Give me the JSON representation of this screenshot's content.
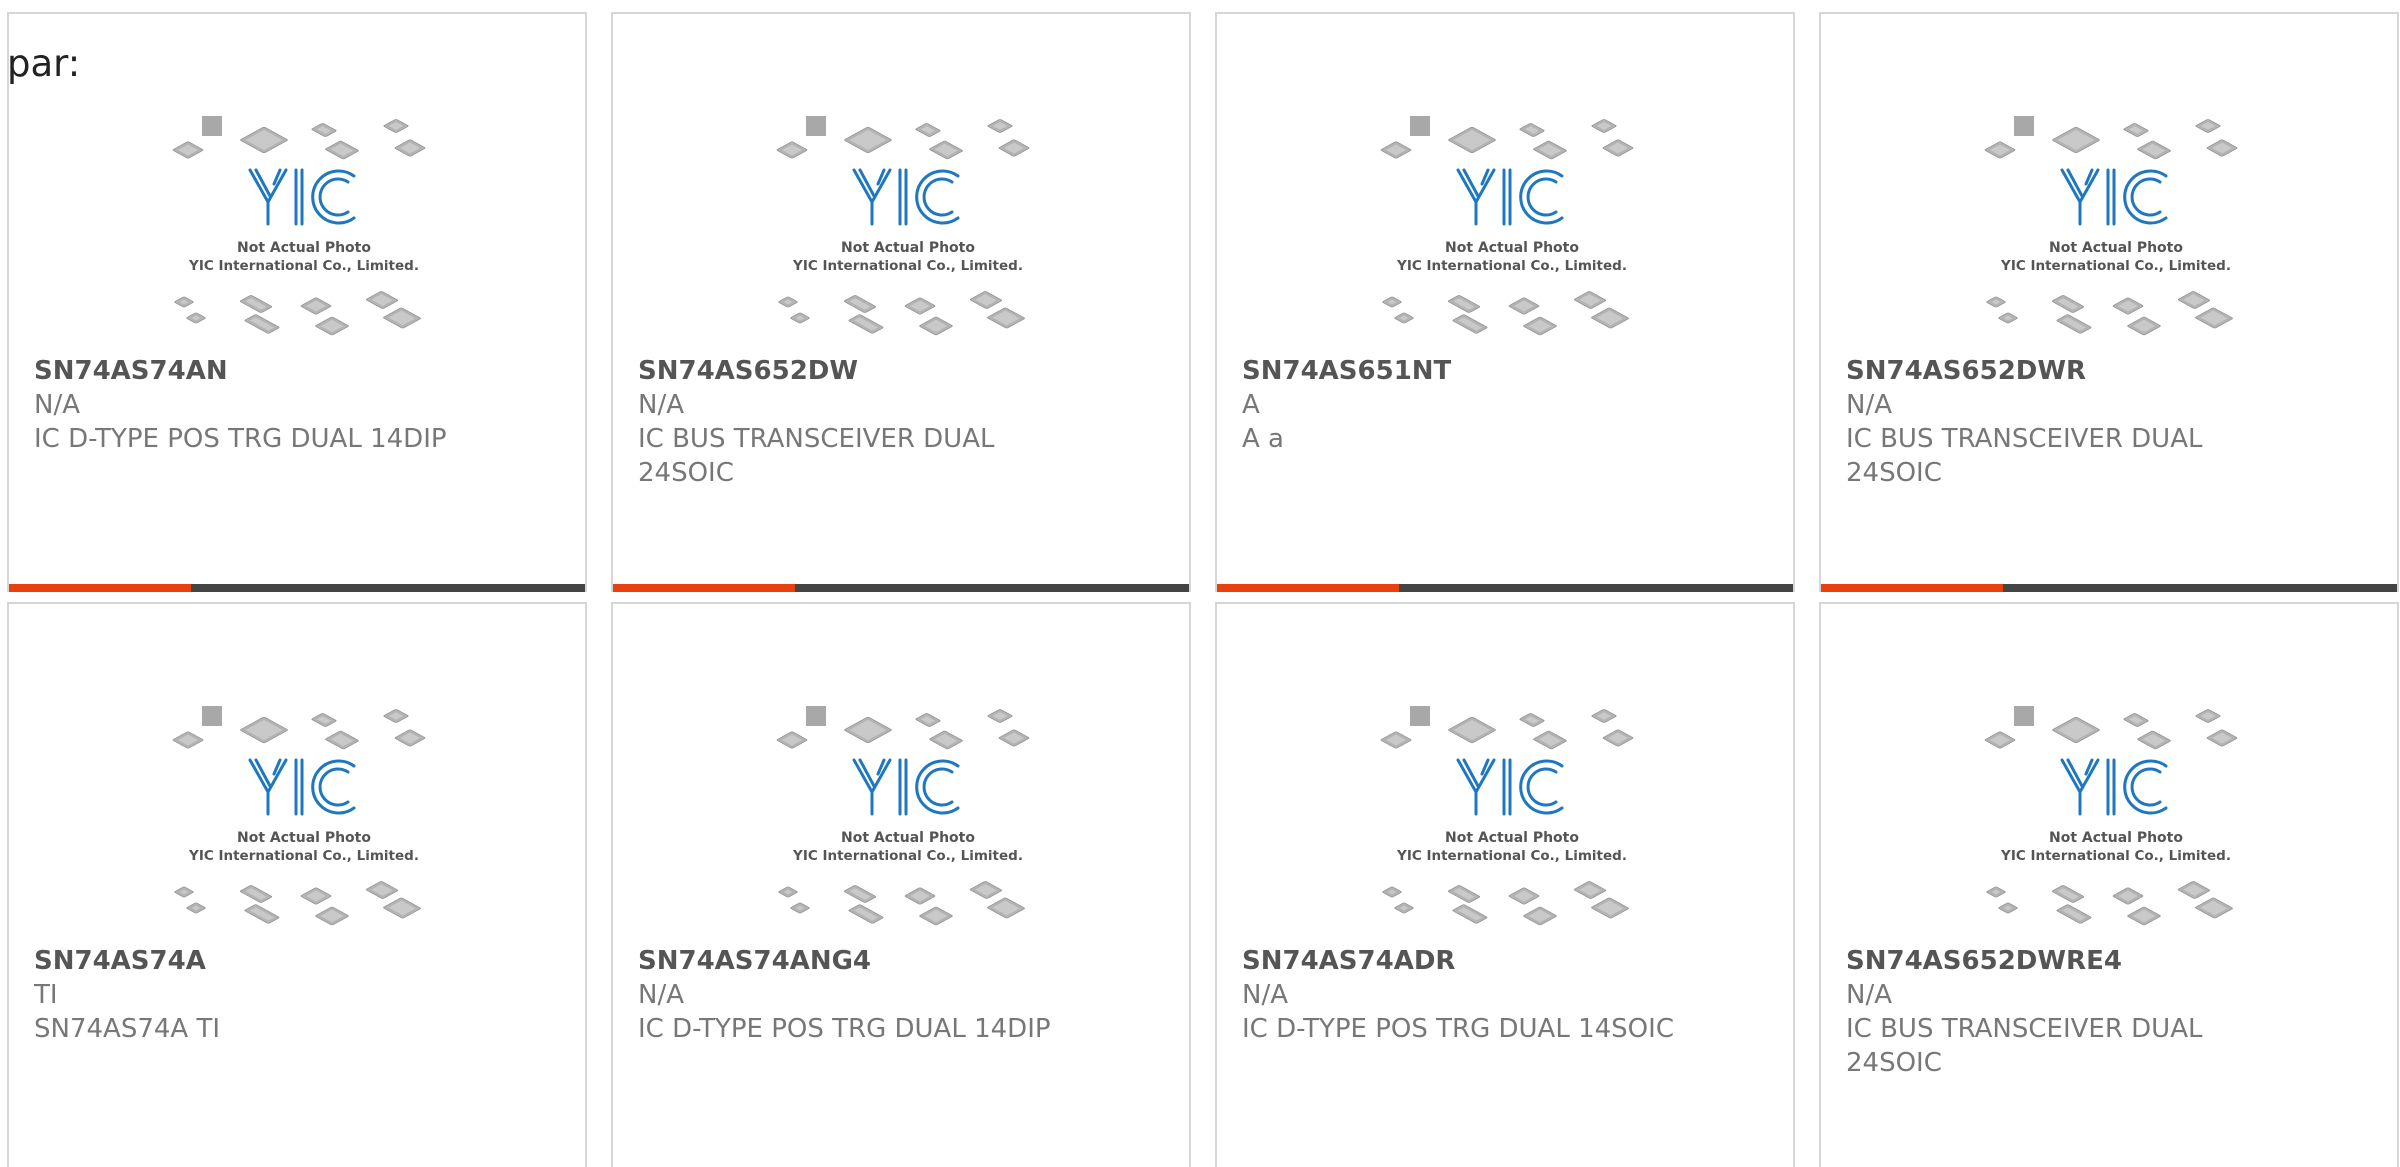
{
  "prefix_text": "par:",
  "photo": {
    "brand": "YIC",
    "caption_line1": "Not Actual Photo",
    "caption_line2": "YIC International Co., Limited."
  },
  "colors": {
    "accent": "#e8400f",
    "bar": "#444444",
    "logo_blue": "#1f77c0"
  },
  "products": [
    {
      "part_no": "SN74AS74AN",
      "manufacturer": "N/A",
      "description": "IC D-TYPE POS TRG DUAL 14DIP"
    },
    {
      "part_no": "SN74AS652DW",
      "manufacturer": "N/A",
      "description": "IC BUS TRANSCEIVER DUAL 24SOIC"
    },
    {
      "part_no": "SN74AS651NT",
      "manufacturer": "A",
      "description": "A a"
    },
    {
      "part_no": "SN74AS652DWR",
      "manufacturer": "N/A",
      "description": "IC BUS TRANSCEIVER DUAL 24SOIC"
    },
    {
      "part_no": "SN74AS74A",
      "manufacturer": "TI",
      "description": "SN74AS74A TI"
    },
    {
      "part_no": "SN74AS74ANG4",
      "manufacturer": "N/A",
      "description": "IC D-TYPE POS TRG DUAL 14DIP"
    },
    {
      "part_no": "SN74AS74ADR",
      "manufacturer": "N/A",
      "description": "IC D-TYPE POS TRG DUAL 14SOIC"
    },
    {
      "part_no": "SN74AS652DWRE4",
      "manufacturer": "N/A",
      "description": "IC BUS TRANSCEIVER DUAL 24SOIC"
    }
  ]
}
